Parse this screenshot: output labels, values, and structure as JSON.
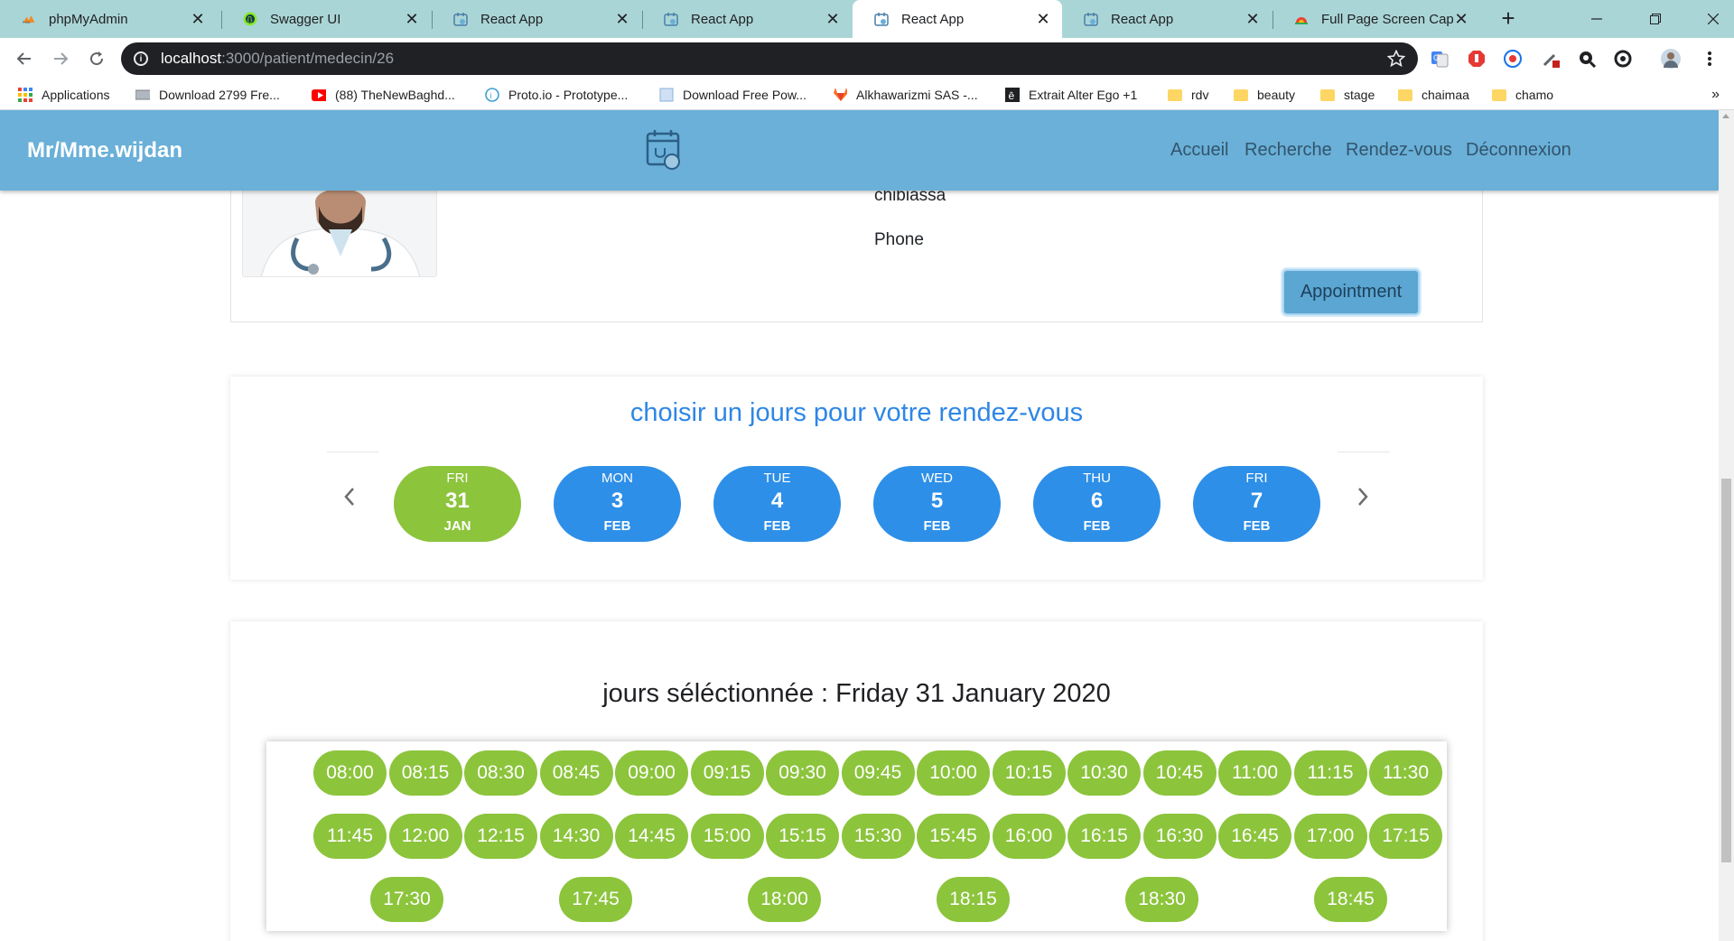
{
  "browser": {
    "tabs": [
      {
        "title": "phpMyAdmin",
        "icon": "phpmyadmin-icon",
        "active": false
      },
      {
        "title": "Swagger UI",
        "icon": "swagger-icon",
        "active": false
      },
      {
        "title": "React App",
        "icon": "react-app-icon",
        "active": false
      },
      {
        "title": "React App",
        "icon": "react-app-icon",
        "active": false
      },
      {
        "title": "React App",
        "icon": "react-app-icon",
        "active": true
      },
      {
        "title": "React App",
        "icon": "react-app-icon",
        "active": false
      },
      {
        "title": "Full Page Screen Captu",
        "icon": "screen-capture-icon",
        "active": false
      }
    ],
    "url_host": "localhost",
    "url_path": ":3000/patient/medecin/26",
    "bookmarks": [
      {
        "label": "Applications",
        "icon": "apps-grid-icon"
      },
      {
        "label": "Download 2799 Fre...",
        "icon": "download-site-icon"
      },
      {
        "label": "(88) TheNewBaghd...",
        "icon": "youtube-icon"
      },
      {
        "label": "Proto.io - Prototype...",
        "icon": "protoio-icon"
      },
      {
        "label": "Download Free Pow...",
        "icon": "page-icon"
      },
      {
        "label": "Alkhawarizmi SAS -...",
        "icon": "gitlab-icon"
      },
      {
        "label": "Extrait Alter Ego +1",
        "icon": "e-book-icon"
      },
      {
        "label": "rdv",
        "icon": "folder-icon"
      },
      {
        "label": "beauty",
        "icon": "folder-icon"
      },
      {
        "label": "stage",
        "icon": "folder-icon"
      },
      {
        "label": "chaimaa",
        "icon": "folder-icon"
      },
      {
        "label": "chamo",
        "icon": "folder-icon"
      }
    ],
    "more_bookmarks": "»"
  },
  "app": {
    "brand": "Mr/Mme.wijdan",
    "nav": [
      "Accueil",
      "Recherche",
      "Rendez-vous",
      "Déconnexion"
    ],
    "colors": {
      "navbar": "#6ab0d8",
      "day_pill": "#2d8fe8",
      "selected_pill": "#8cc43c",
      "title_blue": "#2e86e6"
    }
  },
  "doctor": {
    "field1": "chibiassa",
    "field2": "Phone",
    "appointment_label": "Appointment"
  },
  "day_picker": {
    "title": "choisir un jours pour votre rendez-vous",
    "days": [
      {
        "dow": "FRI",
        "num": "31",
        "mon": "JAN",
        "selected": true
      },
      {
        "dow": "MON",
        "num": "3",
        "mon": "FEB",
        "selected": false
      },
      {
        "dow": "TUE",
        "num": "4",
        "mon": "FEB",
        "selected": false
      },
      {
        "dow": "WED",
        "num": "5",
        "mon": "FEB",
        "selected": false
      },
      {
        "dow": "THU",
        "num": "6",
        "mon": "FEB",
        "selected": false
      },
      {
        "dow": "FRI",
        "num": "7",
        "mon": "FEB",
        "selected": false
      }
    ]
  },
  "time_slots": {
    "selected_label": "jours séléctionnée : Friday 31 January 2020",
    "row1": [
      "08:00",
      "08:15",
      "08:30",
      "08:45",
      "09:00",
      "09:15",
      "09:30",
      "09:45",
      "10:00",
      "10:15",
      "10:30",
      "10:45",
      "11:00",
      "11:15",
      "11:30"
    ],
    "row2": [
      "11:45",
      "12:00",
      "12:15",
      "14:30",
      "14:45",
      "15:00",
      "15:15",
      "15:30",
      "15:45",
      "16:00",
      "16:15",
      "16:30",
      "16:45",
      "17:00",
      "17:15"
    ],
    "row3": [
      "17:30",
      "17:45",
      "18:00",
      "18:15",
      "18:30",
      "18:45"
    ]
  }
}
